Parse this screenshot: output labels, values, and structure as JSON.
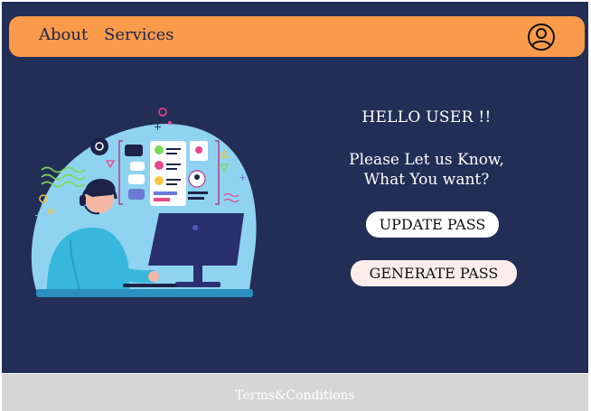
{
  "nav": {
    "about_label": "About",
    "services_label": "Services",
    "profile_icon": "user-circle-icon"
  },
  "main": {
    "greeting": "HELLO USER !!",
    "prompt_line1": "Please Let us Know,",
    "prompt_line2": "What You want?",
    "update_button_label": "UPDATE PASS",
    "generate_button_label": "GENERATE PASS",
    "illustration_icon": "customer-support-agent-illustration"
  },
  "footer": {
    "terms_label": "Terms&Conditions"
  },
  "colors": {
    "background": "#232e56",
    "navbar": "#fa9b4b",
    "footer": "#d6d6d6",
    "button": "#ffffff",
    "button_alt": "#fbeeea"
  }
}
